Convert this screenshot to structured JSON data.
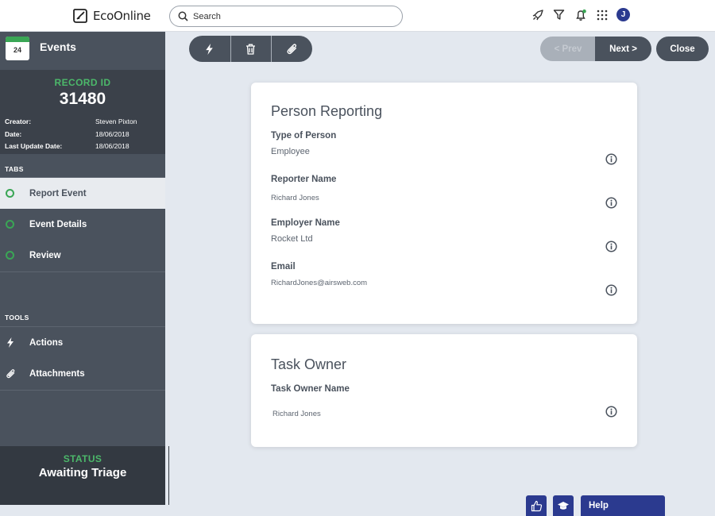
{
  "topbar": {
    "brand": "EcoOnline",
    "search_placeholder": "Search",
    "avatar_initial": "J"
  },
  "sidebar": {
    "title": "Events",
    "calendar_day": "24",
    "record_label": "RECORD ID",
    "record_id": "31480",
    "meta": [
      {
        "label": "Creator:",
        "value": "Steven Pixton"
      },
      {
        "label": "Date:",
        "value": "18/06/2018"
      },
      {
        "label": "Last Update Date:",
        "value": "18/06/2018"
      }
    ],
    "tabs_label": "TABS",
    "tabs": [
      {
        "label": "Report Event",
        "active": true
      },
      {
        "label": "Event Details",
        "active": false
      },
      {
        "label": "Review",
        "active": false
      }
    ],
    "tools_label": "TOOLS",
    "tools": [
      {
        "label": "Actions",
        "icon": "lightning-icon"
      },
      {
        "label": "Attachments",
        "icon": "paperclip-icon"
      }
    ],
    "status_label": "STATUS",
    "status_value": "Awaiting Triage"
  },
  "toolbar": {
    "prev_label": "< Prev",
    "next_label": "Next >",
    "close_label": "Close"
  },
  "person_reporting": {
    "title": "Person Reporting",
    "fields": [
      {
        "label": "Type of Person",
        "value": "Employee"
      },
      {
        "label": "Reporter Name",
        "value": "Richard Jones"
      },
      {
        "label": "Employer Name",
        "value": "Rocket Ltd"
      },
      {
        "label": "Email",
        "value": "RichardJones@airsweb.com"
      }
    ]
  },
  "task_owner": {
    "title": "Task Owner",
    "fields": [
      {
        "label": "Task Owner Name",
        "value": "Richard Jones"
      }
    ]
  },
  "footer": {
    "help_label": "Help"
  },
  "colors": {
    "accent_green": "#3aa655",
    "sidebar_bg": "#4a525d",
    "brand_blue": "#2b3a8f"
  }
}
